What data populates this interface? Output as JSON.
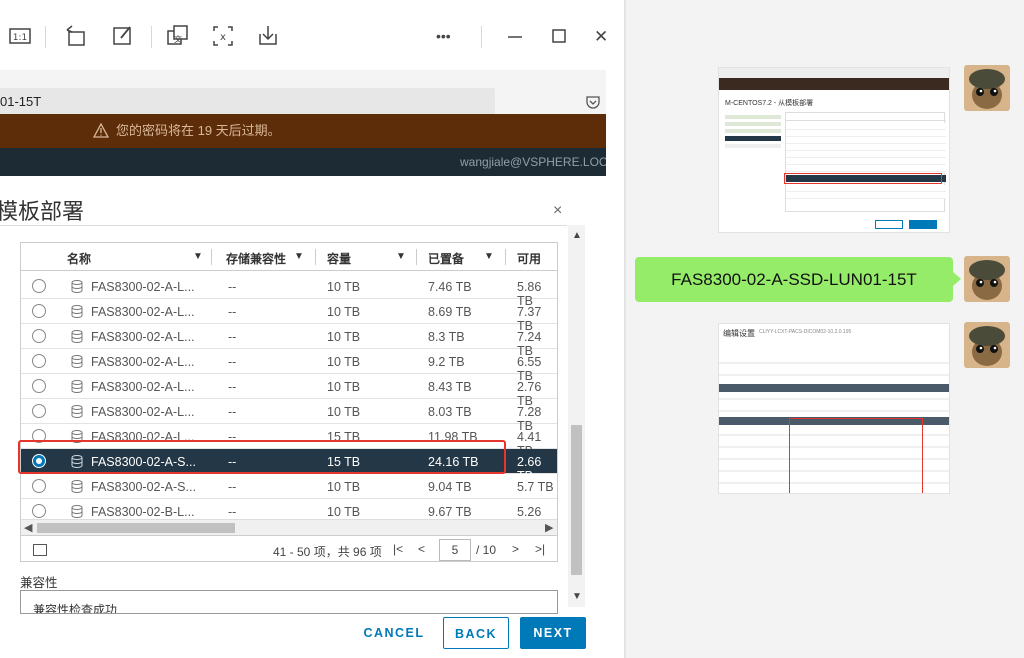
{
  "viewer": {
    "toolbar_icons": [
      "fit-icon",
      "rotate-icon",
      "edit-icon",
      "translate-icon",
      "extract-text-icon",
      "download-icon",
      "more-icon",
      "minimize-icon",
      "maximize-icon",
      "close-icon"
    ],
    "more_label": "•••",
    "close_label": "✕"
  },
  "browser": {
    "url_text": "01-15T",
    "banner_text": "您的密码将在 19 天后过期。",
    "user_text": "wangjiale@VSPHERE.LOC"
  },
  "dialog": {
    "title": "模板部署",
    "close_label": "×",
    "columns": {
      "name": "名称",
      "compat": "存储兼容性",
      "capacity": "容量",
      "provisioned": "已置备",
      "free": "可用"
    },
    "rows": [
      {
        "name": "FAS8300-02-A-L...",
        "compat": "--",
        "capacity": "10 TB",
        "provisioned": "7.46 TB",
        "free": "5.86 TB",
        "selected": false
      },
      {
        "name": "FAS8300-02-A-L...",
        "compat": "--",
        "capacity": "10 TB",
        "provisioned": "8.69 TB",
        "free": "7.37 TB",
        "selected": false
      },
      {
        "name": "FAS8300-02-A-L...",
        "compat": "--",
        "capacity": "10 TB",
        "provisioned": "8.3 TB",
        "free": "7.24 TB",
        "selected": false
      },
      {
        "name": "FAS8300-02-A-L...",
        "compat": "--",
        "capacity": "10 TB",
        "provisioned": "9.2 TB",
        "free": "6.55 TB",
        "selected": false
      },
      {
        "name": "FAS8300-02-A-L...",
        "compat": "--",
        "capacity": "10 TB",
        "provisioned": "8.43 TB",
        "free": "2.76 TB",
        "selected": false
      },
      {
        "name": "FAS8300-02-A-L...",
        "compat": "--",
        "capacity": "10 TB",
        "provisioned": "8.03 TB",
        "free": "7.28 TB",
        "selected": false
      },
      {
        "name": "FAS8300-02-A-L...",
        "compat": "--",
        "capacity": "15 TB",
        "provisioned": "11.98 TB",
        "free": "4.41 TB",
        "selected": false
      },
      {
        "name": "FAS8300-02-A-S...",
        "compat": "--",
        "capacity": "15 TB",
        "provisioned": "24.16 TB",
        "free": "2.66 TB",
        "selected": true
      },
      {
        "name": "FAS8300-02-A-S...",
        "compat": "--",
        "capacity": "10 TB",
        "provisioned": "9.04 TB",
        "free": "5.7 TB",
        "selected": false
      },
      {
        "name": "FAS8300-02-B-L...",
        "compat": "--",
        "capacity": "10 TB",
        "provisioned": "9.67 TB",
        "free": "5.26 TB",
        "selected": false
      }
    ],
    "pagination": {
      "range": "41 - 50 项，共 96 项",
      "current_page": "5",
      "total": "/ 10"
    },
    "compat_label": "兼容性",
    "compat_text": "兼容性检查成功",
    "buttons": {
      "cancel": "CANCEL",
      "back": "BACK",
      "next": "NEXT"
    }
  },
  "chat": {
    "message_text": "FAS8300-02-A-SSD-LUN01-15T",
    "bubble_color": "#95ec69",
    "thumb1_title": "M-CENTOS7.2 - 从模板部署",
    "thumb2_title": "编辑设置",
    "thumb2_subtitle": "CLIYY-LCXT-PACS-DICOM02-10.2.0.195"
  },
  "colors": {
    "accent": "#0079b8",
    "banner_bg": "#5d2d0a",
    "selected_row_bg": "#243746",
    "highlight_box": "#e6352b"
  }
}
